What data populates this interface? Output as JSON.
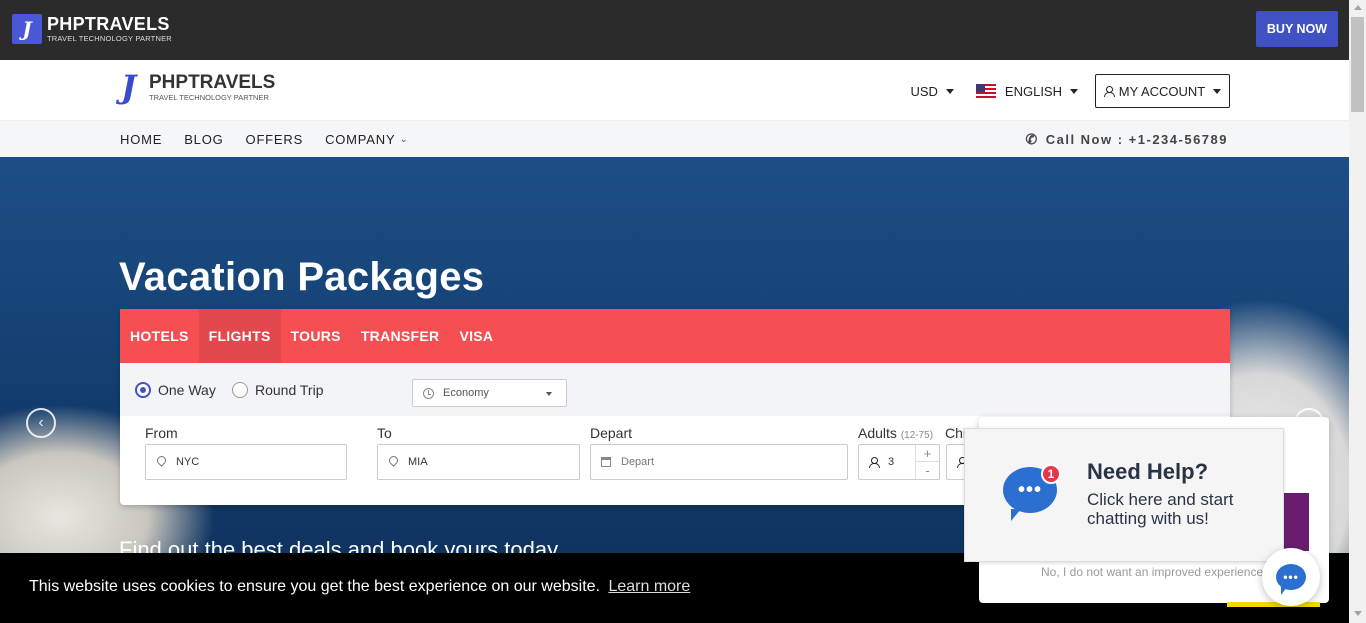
{
  "topbar": {
    "logo_name": "PHPTRAVELS",
    "logo_tagline": "TRAVEL TECHNOLOGY PARTNER",
    "buy_now": "BUY NOW"
  },
  "header": {
    "logo_name": "PHPTRAVELS",
    "logo_tagline": "TRAVEL TECHNOLOGY PARTNER",
    "currency": "USD",
    "language": "ENGLISH",
    "account": "MY ACCOUNT"
  },
  "nav": {
    "items": [
      "HOME",
      "BLOG",
      "OFFERS",
      "COMPANY"
    ],
    "call": "Call Now : +1-234-56789"
  },
  "hero": {
    "title": "Vacation Packages",
    "subtitle": "Find out the best deals and book yours today"
  },
  "search": {
    "tabs": [
      "HOTELS",
      "FLIGHTS",
      "TOURS",
      "TRANSFER",
      "VISA"
    ],
    "active_tab": "FLIGHTS",
    "trip_types": [
      "One Way",
      "Round Trip"
    ],
    "selected_trip": "One Way",
    "cabin_class": "Economy",
    "from_label": "From",
    "from_value": "NYC",
    "to_label": "To",
    "to_value": "MIA",
    "depart_label": "Depart",
    "depart_placeholder": "Depart",
    "adults_label": "Adults",
    "adults_range": "(12-75)",
    "adults_value": "3",
    "children_label": "Chi",
    "stepper_plus": "+",
    "stepper_minus": "-"
  },
  "cookie": {
    "message": "This website uses cookies to ensure you get the best experience on our website.",
    "learn_more": "Learn more"
  },
  "chat": {
    "badge_count": "1",
    "title": "Need Help?",
    "text": "Click here and start chatting with us!",
    "decline": "No, I do not want an improved experience",
    "bubble_dots": "•••"
  },
  "colors": {
    "brand": "#3f51c4",
    "tabs_bg": "#f54f53",
    "topbar_bg": "#2b2b2b",
    "chat_blue": "#2b6fd1"
  }
}
